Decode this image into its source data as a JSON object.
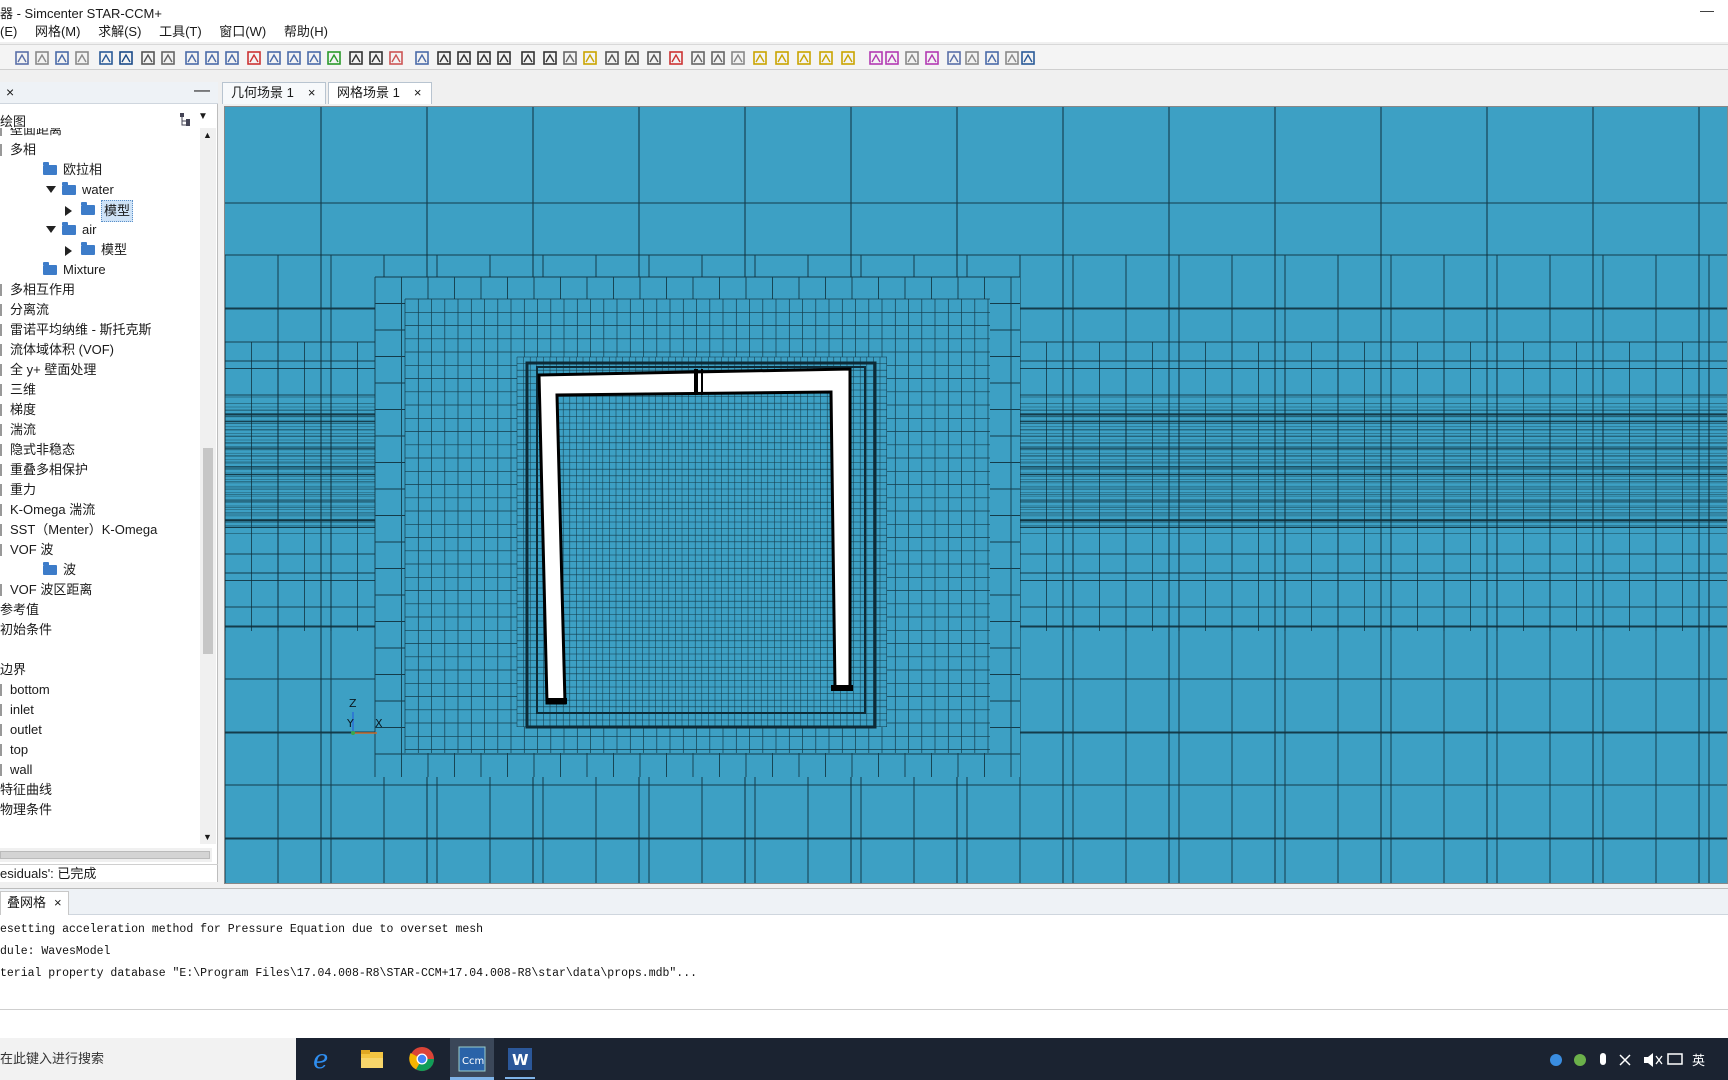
{
  "window": {
    "title": "器 - Simcenter STAR-CCM+",
    "minimize": "—"
  },
  "menubar": [
    "(E)",
    "网格(M)",
    "求解(S)",
    "工具(T)",
    "窗口(W)",
    "帮助(H)"
  ],
  "left_panel": {
    "tab_close": "×",
    "collapse": "—",
    "header": "绘图",
    "tree": [
      {
        "label": "壁面距离",
        "indent": 0,
        "clipped": true
      },
      {
        "label": "多相",
        "indent": 0
      },
      {
        "label": "欧拉相",
        "indent": 1,
        "folder": true
      },
      {
        "label": "water",
        "indent": 2,
        "folder": true,
        "expanded": true
      },
      {
        "label": "模型",
        "indent": 3,
        "folder": true,
        "collapsed": true,
        "selected": true
      },
      {
        "label": "air",
        "indent": 2,
        "folder": true,
        "expanded": true
      },
      {
        "label": "模型",
        "indent": 3,
        "folder": true,
        "collapsed": true
      },
      {
        "label": "Mixture",
        "indent": 1,
        "folder": true
      },
      {
        "label": "多相互作用",
        "indent": 0
      },
      {
        "label": "分离流",
        "indent": 0
      },
      {
        "label": "雷诺平均纳维 - 斯托克斯",
        "indent": 0
      },
      {
        "label": "流体域体积 (VOF)",
        "indent": 0
      },
      {
        "label": "全 y+ 壁面处理",
        "indent": 0
      },
      {
        "label": "三维",
        "indent": 0
      },
      {
        "label": "梯度",
        "indent": 0
      },
      {
        "label": "湍流",
        "indent": 0
      },
      {
        "label": "隐式非稳态",
        "indent": 0
      },
      {
        "label": "重叠多相保护",
        "indent": 0
      },
      {
        "label": "重力",
        "indent": 0
      },
      {
        "label": "K-Omega 湍流",
        "indent": 0
      },
      {
        "label": "SST（Menter）K-Omega",
        "indent": 0
      },
      {
        "label": "VOF 波",
        "indent": 0
      },
      {
        "label": "波",
        "indent": 1,
        "folder": true
      },
      {
        "label": "VOF 波区距离",
        "indent": 0
      },
      {
        "label": "参考值",
        "indent": -1
      },
      {
        "label": "初始条件",
        "indent": -1
      },
      {
        "label": "",
        "indent": -1
      },
      {
        "label": "边界",
        "indent": -1
      },
      {
        "label": "bottom",
        "indent": 0
      },
      {
        "label": "inlet",
        "indent": 0
      },
      {
        "label": "outlet",
        "indent": 0
      },
      {
        "label": "top",
        "indent": 0
      },
      {
        "label": "wall",
        "indent": 0
      },
      {
        "label": "特征曲线",
        "indent": -1
      },
      {
        "label": "物理条件",
        "indent": -1
      }
    ],
    "status": "esiduals': 已完成"
  },
  "scene_tabs": [
    {
      "label": "几何场景 1",
      "close": "×"
    },
    {
      "label": "网格场景 1",
      "close": "×"
    }
  ],
  "viewport": {
    "background": "#3da0c4",
    "mesh_color": "#0d2a36",
    "structure_color": "#ffffff",
    "axes": {
      "z": "Z",
      "y": "Y",
      "x": "X"
    }
  },
  "output": {
    "tab_label": "叠网格",
    "tab_close": "×",
    "lines": [
      "esetting acceleration method for Pressure Equation due to overset mesh",
      "dule: WavesModel",
      "terial property database \"E:\\Program Files\\17.04.008-R8\\STAR-CCM+17.04.008-R8\\star\\data\\props.mdb\"..."
    ]
  },
  "taskbar": {
    "search_placeholder": "在此键入进行搜索",
    "apps": [
      "edge-icon",
      "file-explorer-icon",
      "chrome-icon",
      "starccm-icon",
      "word-icon"
    ],
    "starccm_label": "Ccm",
    "word_label": "W",
    "ime": "英"
  }
}
